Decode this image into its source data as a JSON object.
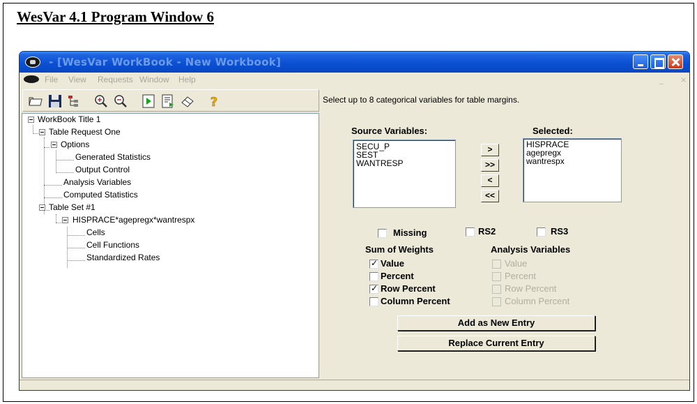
{
  "document": {
    "heading": "WesVar 4.1 Program Window 6"
  },
  "window": {
    "title": "- [WesVar WorkBook - New Workbook]",
    "menu": [
      "File",
      "View",
      "Requests",
      "Window",
      "Help"
    ],
    "mdi_controls": [
      "_",
      "×"
    ],
    "hint": "Select up to 8 categorical variables for table margins."
  },
  "tree": {
    "nodes": [
      {
        "label": "WorkBook Title 1"
      },
      {
        "label": "Table Request One"
      },
      {
        "label": "Options"
      },
      {
        "label": "Generated Statistics"
      },
      {
        "label": "Output Control"
      },
      {
        "label": "Analysis Variables"
      },
      {
        "label": "Computed Statistics"
      },
      {
        "label": "Table Set #1"
      },
      {
        "label": "HISPRACE*agepregx*wantrespx"
      },
      {
        "label": "Cells"
      },
      {
        "label": "Cell Functions"
      },
      {
        "label": "Standardized Rates"
      }
    ]
  },
  "form": {
    "source_label": "Source Variables:",
    "selected_label": "Selected:",
    "source_items": [
      "SECU_P",
      "SEST",
      "WANTRESP"
    ],
    "selected_items": [
      "HISPRACE",
      "agepregx",
      "wantrespx"
    ],
    "arrows": [
      ">",
      ">>",
      "<",
      "<<"
    ],
    "options": [
      {
        "label": "Missing",
        "checked": false
      },
      {
        "label": "RS2",
        "checked": false
      },
      {
        "label": "RS3",
        "checked": false
      }
    ],
    "sum_of_weights_label": "Sum of Weights",
    "analysis_variables_label": "Analysis Variables",
    "sum_of_weights": [
      {
        "label": "Value",
        "checked": true
      },
      {
        "label": "Percent",
        "checked": false
      },
      {
        "label": "Row Percent",
        "checked": true
      },
      {
        "label": "Column Percent",
        "checked": false
      }
    ],
    "analysis_variables": [
      {
        "label": "Value",
        "checked": false,
        "disabled": true
      },
      {
        "label": "Percent",
        "checked": false,
        "disabled": true
      },
      {
        "label": "Row Percent",
        "checked": false,
        "disabled": true
      },
      {
        "label": "Column Percent",
        "checked": false,
        "disabled": true
      }
    ],
    "add_button": "Add as New Entry",
    "replace_button": "Replace Current Entry"
  },
  "toolbar": {
    "icons": [
      "open-folder-icon",
      "save-icon",
      "tree-icon",
      "zoom-in-icon",
      "zoom-out-icon",
      "run-icon",
      "export-icon",
      "eraser-icon",
      "help-icon"
    ]
  }
}
